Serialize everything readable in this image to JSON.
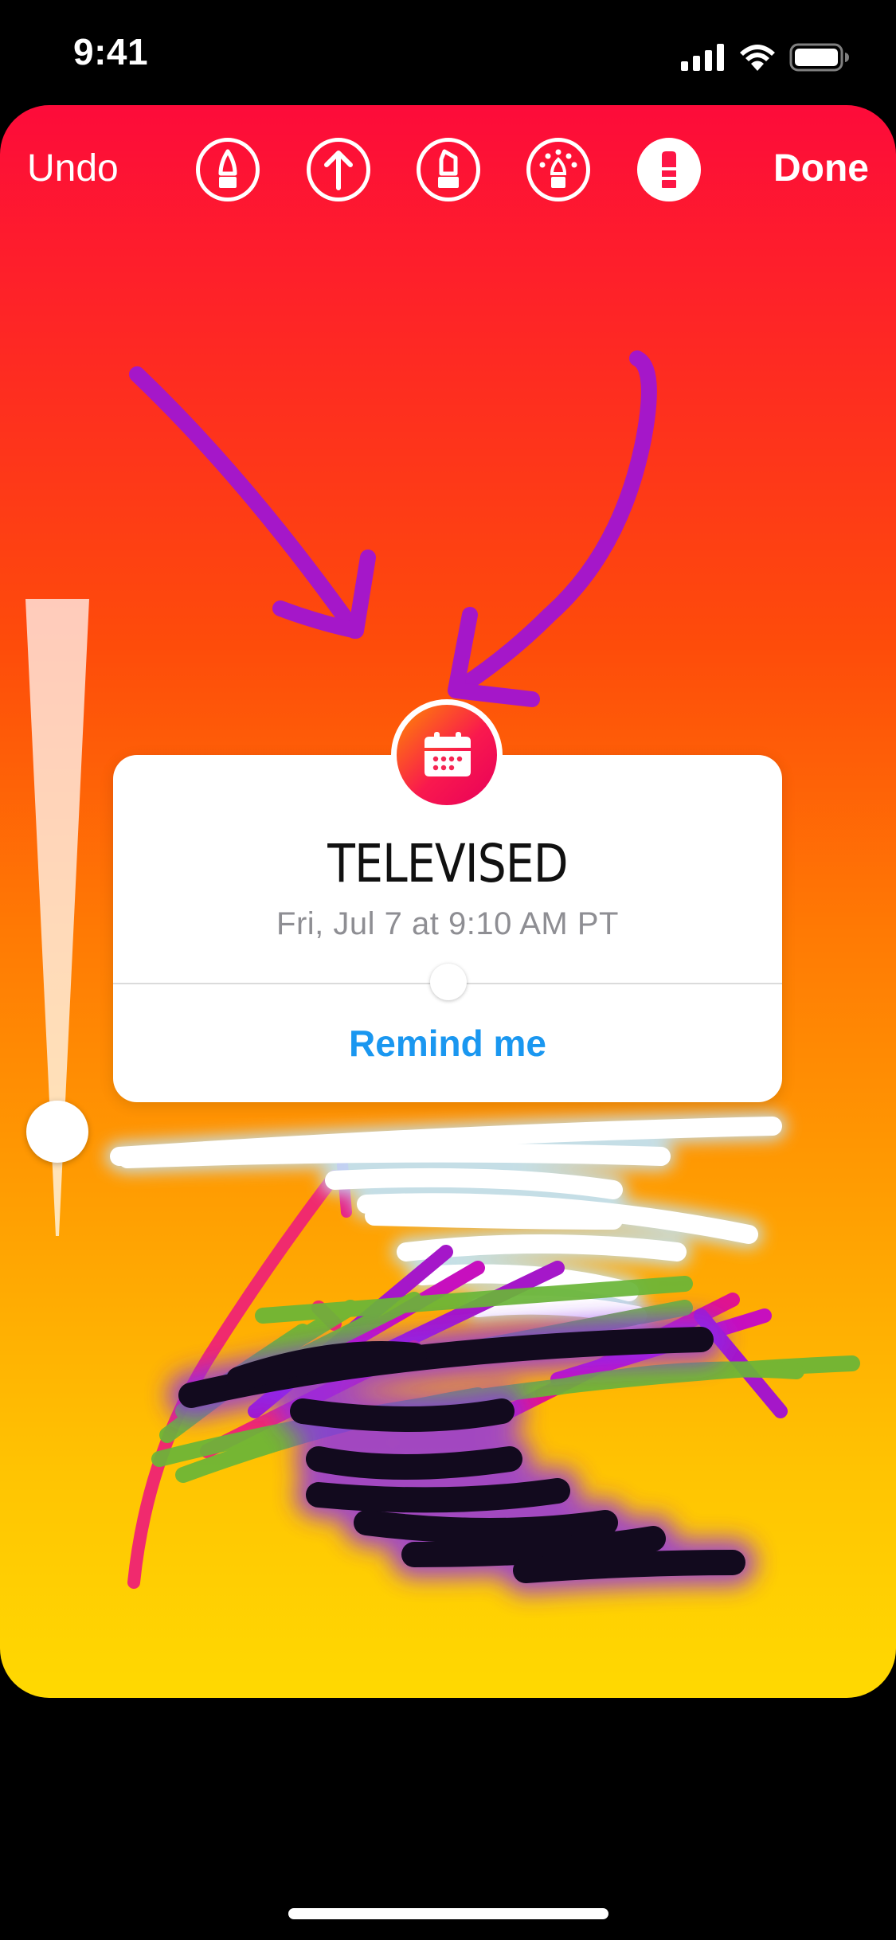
{
  "status_bar": {
    "time": "9:41"
  },
  "toolbar": {
    "undo_label": "Undo",
    "done_label": "Done",
    "tools": [
      {
        "name": "pen-icon",
        "active": false
      },
      {
        "name": "arrow-pen-icon",
        "active": false
      },
      {
        "name": "marker-icon",
        "active": false
      },
      {
        "name": "neon-pen-icon",
        "active": false
      },
      {
        "name": "eraser-icon",
        "active": true
      }
    ]
  },
  "sticker": {
    "icon": "calendar-icon",
    "title": "TELEVISED",
    "date": "Fri, Jul 7 at 9:10 AM PT",
    "button_label": "Remind me"
  },
  "colors": {
    "gradient_top": "#fd0b3a",
    "gradient_bottom": "#ffd901",
    "accent_blue": "#1a97f0",
    "drawing_purple": "#a517c9",
    "drawing_green": "#6ab638",
    "drawing_pink": "#f02a6e"
  }
}
